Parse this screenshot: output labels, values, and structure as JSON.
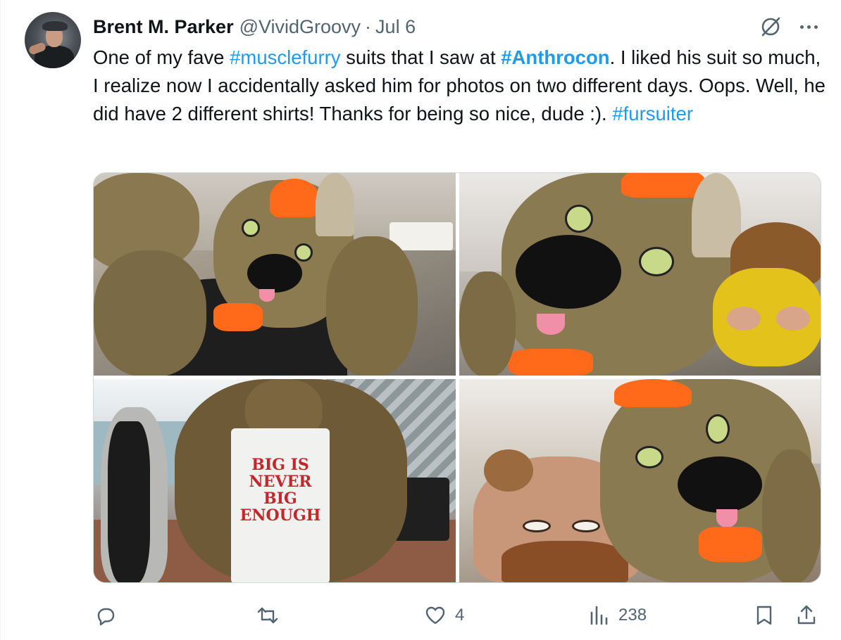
{
  "author": {
    "display_name": "Brent M. Parker",
    "handle": "@VividGroovy",
    "separator": "·",
    "date": "Jul 6",
    "avatar_icon": "user-avatar"
  },
  "tweet": {
    "text_parts": [
      {
        "text": "One of my fave ",
        "type": "plain"
      },
      {
        "text": "#musclefurry",
        "type": "hashtag"
      },
      {
        "text": " suits that I saw at ",
        "type": "plain"
      },
      {
        "text": "#Anthrocon",
        "type": "hashtag-bold"
      },
      {
        "text": ". I liked his suit so much, I realize now I accidentally asked him for photos on two different days. Oops. Well, he did have 2 different shirts! Thanks for being so nice, dude :). ",
        "type": "plain"
      },
      {
        "text": "#fursuiter",
        "type": "hashtag"
      }
    ]
  },
  "media": {
    "photos": [
      {
        "shirt_text": ""
      },
      {
        "shirt_text": ""
      },
      {
        "shirt_text": "BIG IS NEVER BIG ENOUGH"
      },
      {
        "shirt_text": ""
      }
    ]
  },
  "actions": {
    "reply": {
      "icon": "reply-icon",
      "count": ""
    },
    "repost": {
      "icon": "repost-icon",
      "count": ""
    },
    "like": {
      "icon": "heart-icon",
      "count": "4"
    },
    "views": {
      "icon": "views-icon",
      "count": "238"
    },
    "bookmark": {
      "icon": "bookmark-icon"
    },
    "share": {
      "icon": "share-icon"
    }
  },
  "colors": {
    "link": "#1d9bf0",
    "text": "#0f1419",
    "muted": "#536471",
    "border": "#cfd9de"
  }
}
